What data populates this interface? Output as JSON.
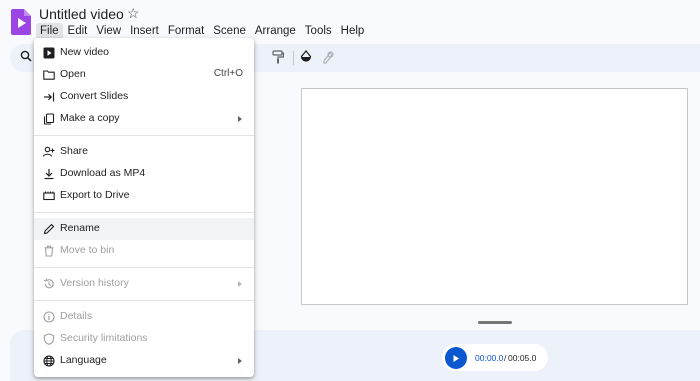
{
  "app": {
    "title": "Untitled video",
    "logo_color": "#9b45e4"
  },
  "menubar": [
    "File",
    "Edit",
    "View",
    "Insert",
    "Format",
    "Scene",
    "Arrange",
    "Tools",
    "Help"
  ],
  "menu": {
    "items": [
      {
        "label": "New video",
        "icon": "new-video-icon"
      },
      {
        "label": "Open",
        "icon": "folder-icon",
        "shortcut": "Ctrl+O"
      },
      {
        "label": "Convert Slides",
        "icon": "convert-icon"
      },
      {
        "label": "Make a copy",
        "icon": "copy-icon",
        "submenu": true
      },
      {
        "label": "Share",
        "icon": "share-icon"
      },
      {
        "label": "Download as MP4",
        "icon": "download-icon"
      },
      {
        "label": "Export to Drive",
        "icon": "drive-export-icon"
      },
      {
        "label": "Rename",
        "icon": "pencil-icon",
        "hover": true
      },
      {
        "label": "Move to bin",
        "icon": "trash-icon",
        "disabled": true
      },
      {
        "label": "Version history",
        "icon": "history-icon",
        "disabled": true,
        "submenu": true
      },
      {
        "label": "Details",
        "icon": "info-icon",
        "disabled": true
      },
      {
        "label": "Security limitations",
        "icon": "shield-icon",
        "disabled": true
      },
      {
        "label": "Language",
        "icon": "globe-icon",
        "submenu": true
      }
    ]
  },
  "player": {
    "current": "00:00.0",
    "separator": "/",
    "total": "00:05.0"
  },
  "colors": {
    "accent": "#0b57d0",
    "toolbar_bg": "#edf2fa",
    "page_bg": "#f8fafd"
  }
}
